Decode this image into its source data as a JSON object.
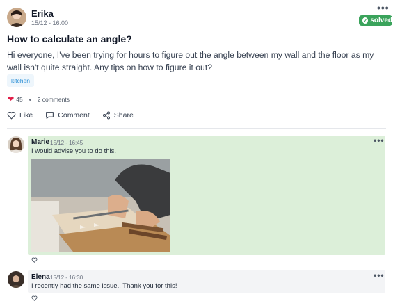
{
  "post": {
    "author": "Erika",
    "timestamp": "15/12 - 16:00",
    "status": "solved",
    "title": "How to calculate an angle?",
    "body": "Hi everyone, I've been trying for hours to figure out the angle between my wall and the floor as my wall isn't quite straight. Any tips on how to figure it out?",
    "tag": "kitchen",
    "reaction_count": "45",
    "comments_count": "2 comments",
    "actions": {
      "like": "Like",
      "comment": "Comment",
      "share": "Share"
    },
    "menu_icon": "more-horizontal-icon"
  },
  "comments": [
    {
      "author": "Marie",
      "timestamp": "15/12 - 16:45",
      "text": "I would advise you to do this.",
      "has_image": true,
      "image_description_icon": "photo-woodworking"
    },
    {
      "author": "Elena",
      "timestamp": "15/12 - 16:30",
      "text": "I recently had the same issue.. Thank you for this!",
      "has_image": false
    }
  ],
  "colors": {
    "solved_badge": "#3aa35b",
    "accepted_comment_bg": "#dcefd9",
    "comment_bg": "#f3f4f6",
    "tag_text": "#2b8fd6",
    "tag_bg": "#eef6fc"
  }
}
